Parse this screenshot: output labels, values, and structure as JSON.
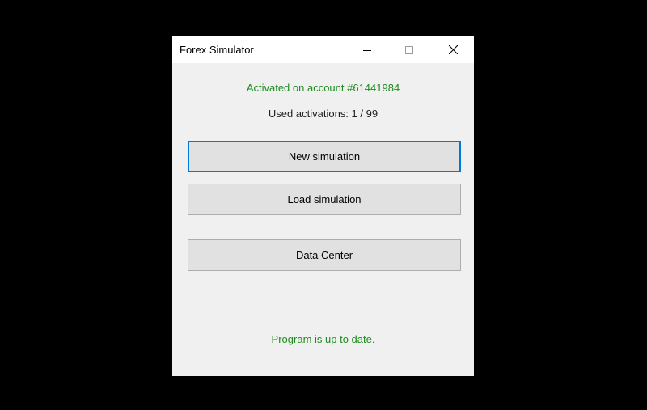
{
  "window": {
    "title": "Forex Simulator"
  },
  "status": {
    "activated_text": "Activated on account #61441984",
    "used_activations_text": "Used activations: 1 / 99",
    "update_text": "Program is up to date."
  },
  "buttons": {
    "new_simulation": "New simulation",
    "load_simulation": "Load simulation",
    "data_center": "Data Center"
  },
  "colors": {
    "status_green": "#1e8a1e",
    "focus_border": "#0078d7"
  },
  "icons": {
    "minimize": "minimize-icon",
    "maximize": "maximize-icon",
    "close": "close-icon"
  }
}
